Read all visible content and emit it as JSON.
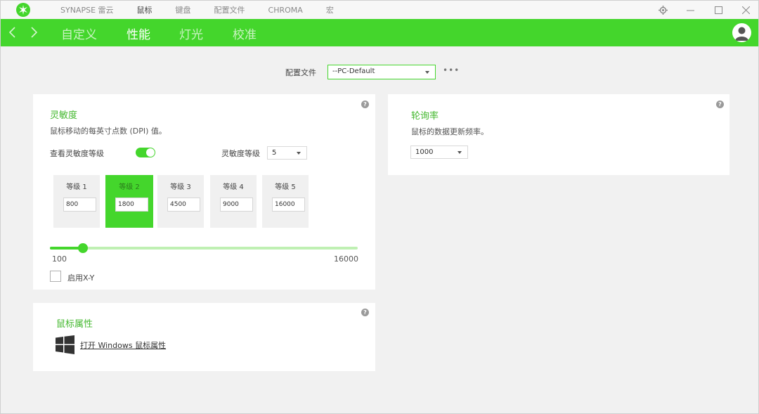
{
  "titlebar": {
    "nav": [
      "SYNAPSE 雷云",
      "鼠标",
      "键盘",
      "配置文件",
      "CHROMA",
      "宏"
    ],
    "active_index": 1,
    "controls": [
      "gear-icon",
      "minimize-icon",
      "maximize-icon",
      "close-icon"
    ]
  },
  "subnav": {
    "tabs": [
      "自定义",
      "性能",
      "灯光",
      "校准"
    ],
    "active_index": 1
  },
  "profile": {
    "label": "配置文件",
    "value": "--PC-Default",
    "more": "•••"
  },
  "sensitivity": {
    "title": "灵敏度",
    "description": "鼠标移动的每英寸点数 (DPI) 值。",
    "toggle_label": "查看灵敏度等级",
    "toggle_on": true,
    "stages_label": "灵敏度等级",
    "stages_value": "5",
    "levels": [
      {
        "label": "等级 1",
        "value": "800"
      },
      {
        "label": "等级 2",
        "value": "1800"
      },
      {
        "label": "等级 3",
        "value": "4500"
      },
      {
        "label": "等级 4",
        "value": "9000"
      },
      {
        "label": "等级 5",
        "value": "16000"
      }
    ],
    "active_level": 1,
    "slider_min": "100",
    "slider_max": "16000",
    "slider_value": 1800,
    "xy_label": "启用X-Y"
  },
  "polling": {
    "title": "轮询率",
    "description": "鼠标的数据更新频率。",
    "value": "1000"
  },
  "mouse_props": {
    "title": "鼠标属性",
    "link": "打开 Windows 鼠标属性"
  },
  "colors": {
    "accent": "#44d62c"
  }
}
